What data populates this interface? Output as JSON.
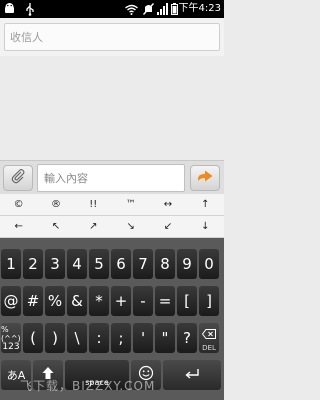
{
  "status_bar": {
    "time": "下午4:23",
    "icons": [
      "android-icon",
      "usb-icon",
      "wifi-icon",
      "silent-icon",
      "signal-icon",
      "battery-icon"
    ]
  },
  "recipient": {
    "placeholder": "收信人"
  },
  "compose": {
    "placeholder": "輸入內容"
  },
  "keyboard": {
    "symbol_row_1": [
      "©",
      "®",
      "!!",
      "™",
      "↔",
      "↑"
    ],
    "symbol_row_2": [
      "←",
      "↖",
      "↗",
      "↘",
      "↙",
      "↓"
    ],
    "number_row": [
      "1",
      "2",
      "3",
      "4",
      "5",
      "6",
      "7",
      "8",
      "9",
      "0"
    ],
    "symbol_row_3": [
      "@",
      "#",
      "%",
      "&",
      "*",
      "+",
      "-",
      "=",
      "[",
      "]"
    ],
    "symbol_row_4": [
      "(",
      ")",
      "\\",
      ":",
      ";",
      "'",
      "\"",
      "?",
      "!"
    ],
    "mode_key": {
      "top": "%(^^)",
      "bottom": "123"
    },
    "delete_key": "DEL",
    "lang_key": "あA",
    "space_key": "space"
  },
  "watermark": "飞下载，BIZZXY.COM"
}
